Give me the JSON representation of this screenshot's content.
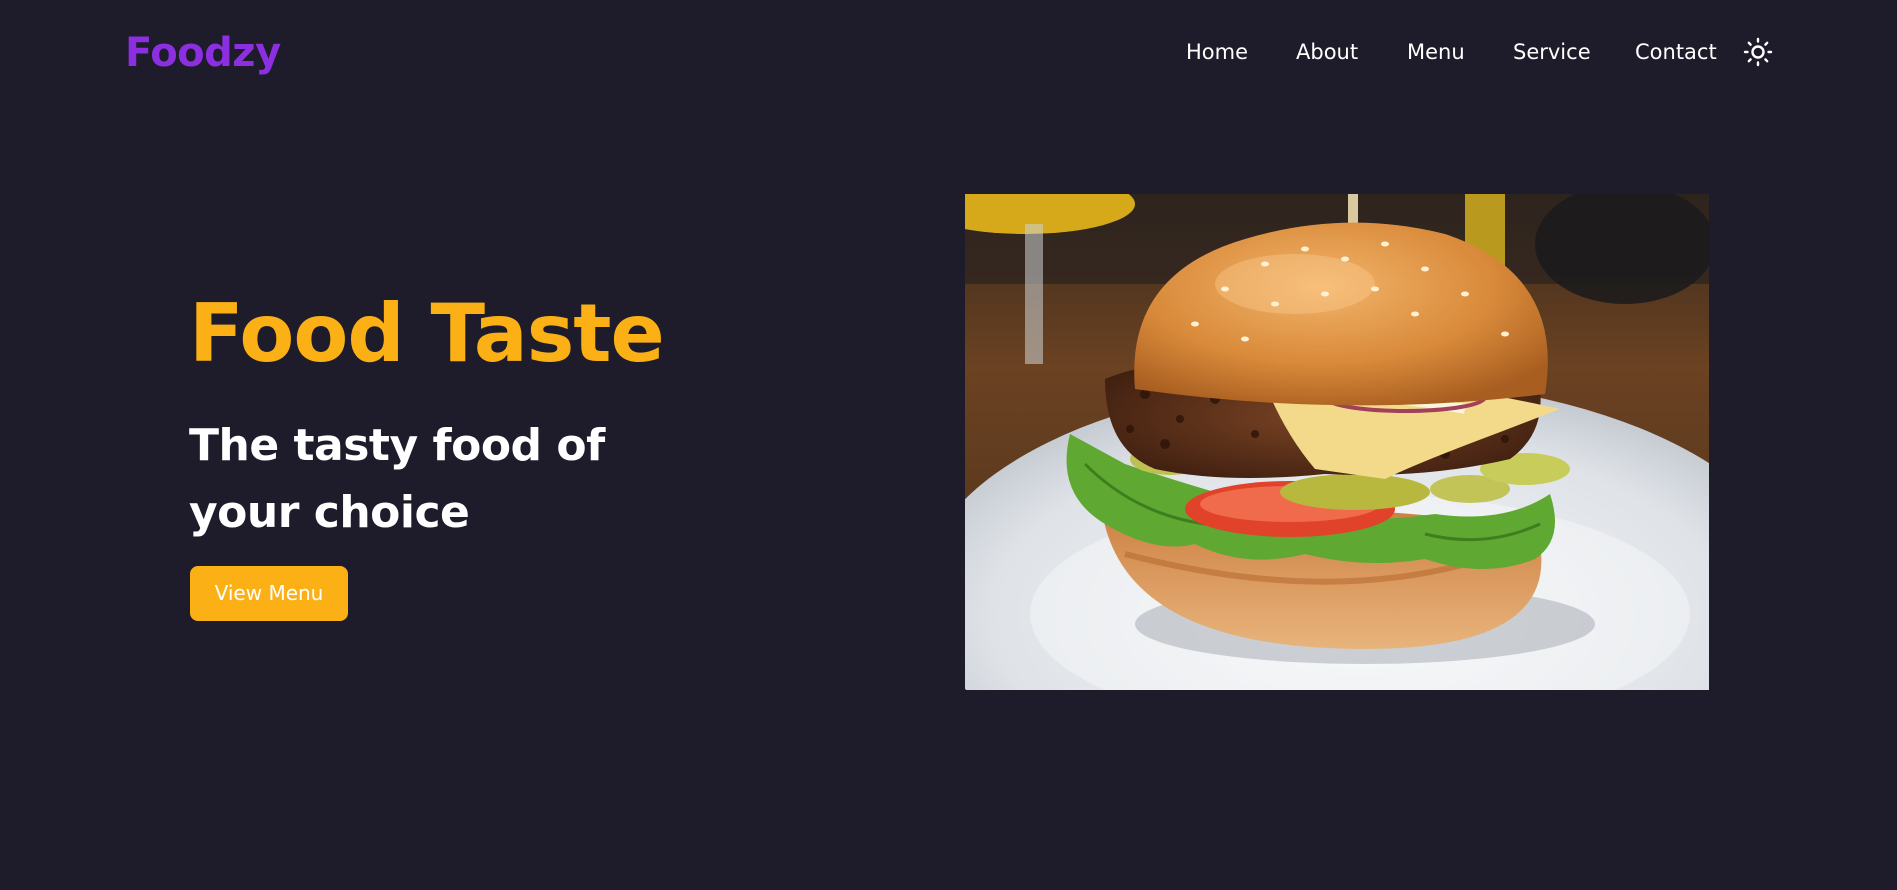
{
  "brand": {
    "name": "Foodzy",
    "color": "#8b2fe0"
  },
  "nav": {
    "items": [
      {
        "label": "Home"
      },
      {
        "label": "About"
      },
      {
        "label": "Menu"
      },
      {
        "label": "Service"
      },
      {
        "label": "Contact"
      }
    ],
    "theme_toggle_icon": "sun-icon"
  },
  "hero": {
    "title": "Food Taste",
    "subtitle": "The tasty food of your choice",
    "cta_label": "View Menu",
    "image_icon": "burger-photo"
  },
  "colors": {
    "background": "#1e1b2b",
    "accent": "#fbb116",
    "text": "#ffffff"
  }
}
